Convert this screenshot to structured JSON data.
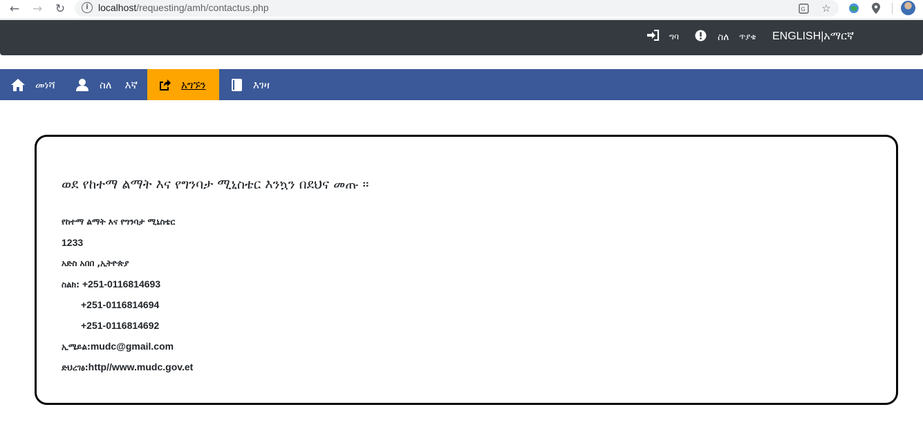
{
  "browser": {
    "url_host": "localhost",
    "url_path": "/requesting/amh/contactus.php"
  },
  "topbar": {
    "login_label": "ግባ",
    "about_label": "ስለ",
    "faq_label": "ጥያቄ",
    "language_label": "ENGLISH|አማርኛ"
  },
  "navbar": {
    "items": [
      {
        "label": "መነሻ",
        "icon": "home-icon"
      },
      {
        "label": "ስለ    እኛ",
        "icon": "user-icon"
      },
      {
        "label": "አግኙን",
        "icon": "share-icon",
        "active": true
      },
      {
        "label": "እገዛ",
        "icon": "book-icon"
      }
    ],
    "active_color": "#ffa500",
    "bar_color": "#3b5998"
  },
  "content": {
    "title": "ወደ የከተማ ልማት እና የግንባታ ሚኒስቴር እንኳን በደህና መጡ ፡፡",
    "org_name": "የከተማ ልማት እና የግንባታ ሚኒስቴር",
    "po_box": "1233",
    "address": "አድስ አበበ ,ኢትዮጵያ",
    "phone_label": "ስልክ:",
    "phones": [
      "+251-0116814693",
      "+251-0116814694",
      "+251-0116814692"
    ],
    "email_label": "ኢሜይል:",
    "email": "mudc@gmail.com",
    "website_label": "ድህረገፅ:",
    "website": "http//www.mudc.gov.et"
  }
}
